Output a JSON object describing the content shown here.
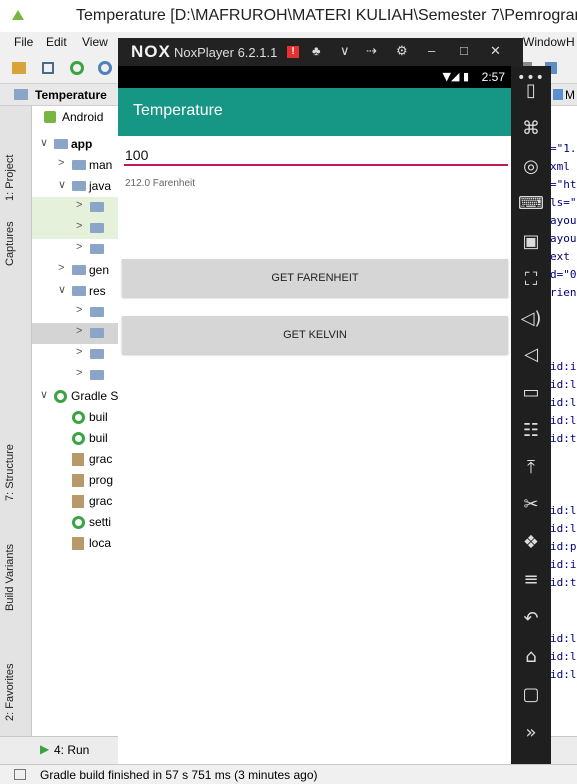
{
  "studio": {
    "window_title": "Temperature [D:\\MAFRUROH\\MATERI KULIAH\\Semester 7\\Pemrogram",
    "menu": [
      "File",
      "Edit",
      "View",
      "Window",
      "H"
    ],
    "breadcrumb": "Temperature",
    "left_tabs": [
      "1: Project",
      "Captures",
      "7: Structure",
      "Build Variants",
      "2: Favorites"
    ],
    "project_view": "Android",
    "tree": [
      {
        "label": "app",
        "arrow": "∨",
        "indent": 0,
        "icon": "folder"
      },
      {
        "label": "man",
        "arrow": ">",
        "indent": 1,
        "icon": "folder"
      },
      {
        "label": "java",
        "arrow": "∨",
        "indent": 1,
        "icon": "folder"
      },
      {
        "label": "",
        "arrow": ">",
        "indent": 2,
        "icon": "folder"
      },
      {
        "label": "",
        "arrow": ">",
        "indent": 2,
        "icon": "folder"
      },
      {
        "label": "",
        "arrow": ">",
        "indent": 2,
        "icon": "folder"
      },
      {
        "label": "gen",
        "arrow": ">",
        "indent": 1,
        "icon": "folder"
      },
      {
        "label": "res",
        "arrow": "∨",
        "indent": 1,
        "icon": "folder"
      },
      {
        "label": "",
        "arrow": ">",
        "indent": 2,
        "icon": "folder"
      },
      {
        "label": "",
        "arrow": ">",
        "indent": 2,
        "icon": "folder"
      },
      {
        "label": "",
        "arrow": ">",
        "indent": 2,
        "icon": "folder"
      },
      {
        "label": "",
        "arrow": ">",
        "indent": 2,
        "icon": "folder"
      },
      {
        "label": "Gradle S",
        "arrow": "∨",
        "indent": 0,
        "icon": "gradle"
      },
      {
        "label": "buil",
        "arrow": "",
        "indent": 1,
        "icon": "gradle"
      },
      {
        "label": "buil",
        "arrow": "",
        "indent": 1,
        "icon": "gradle"
      },
      {
        "label": "grac",
        "arrow": "",
        "indent": 1,
        "icon": "file"
      },
      {
        "label": "prog",
        "arrow": "",
        "indent": 1,
        "icon": "file"
      },
      {
        "label": "grac",
        "arrow": "",
        "indent": 1,
        "icon": "file"
      },
      {
        "label": "setti",
        "arrow": "",
        "indent": 1,
        "icon": "gradle"
      },
      {
        "label": "loca",
        "arrow": "",
        "indent": 1,
        "icon": "file"
      }
    ],
    "editor_lines": [
      "=\"1.",
      " xml",
      "=\"ht",
      "ls=\"",
      "ayou",
      "ayou",
      "ext",
      "d=\"0",
      "rien",
      "id:i",
      "id:l",
      "id:l",
      "id:l",
      "id:t",
      "id:l",
      "id:l",
      "id:p",
      "id:i",
      "id:t",
      "id:l",
      "id:l",
      "id:l"
    ],
    "editor_tab": "M",
    "run_tab": "4: Run",
    "status_text": "Gradle build finished in 57 s 751 ms (3 minutes ago)"
  },
  "nox": {
    "logo": "NOX",
    "version": "NoxPlayer 6.2.1.1",
    "alert_badge": "!",
    "title_icons": [
      "shirt-icon",
      "chevron-down-icon",
      "pin-icon",
      "gear-icon",
      "minimize-icon",
      "maximize-icon",
      "close-icon"
    ],
    "title_glyphs": [
      "♣",
      "∨",
      "⇢",
      "⚙",
      "–",
      "□",
      "✕"
    ],
    "status_time": "2:57",
    "status_signal": "▼◢ ▮",
    "more_dots": "•••",
    "side_icons": [
      "phone-icon",
      "apk-icon",
      "location-icon",
      "keyboard-icon",
      "screenshot-icon",
      "fullscreen-icon",
      "volume-up-icon",
      "volume-down-icon",
      "toolbox-icon",
      "shake-icon",
      "install-apk-icon",
      "cut-icon",
      "multi-window-icon",
      "menu-icon",
      "back-icon",
      "home-icon",
      "recents-icon",
      "expand-icon"
    ],
    "side_glyphs": [
      "▯",
      "⌘",
      "◎",
      "⌨",
      "▣",
      "⛶",
      "◁)",
      "◁",
      "▭",
      "☷",
      "⤒",
      "✂",
      "❖",
      "≡",
      "↶",
      "⌂",
      "▢",
      "»"
    ]
  },
  "app": {
    "title": "Temperature",
    "input_value": "100",
    "result_text": "212.0 Farenheit",
    "button_fahrenheit": "GET FARENHEIT",
    "button_kelvin": "GET KELVIN",
    "accent_color": "#169685",
    "underline_color": "#c2185b"
  }
}
